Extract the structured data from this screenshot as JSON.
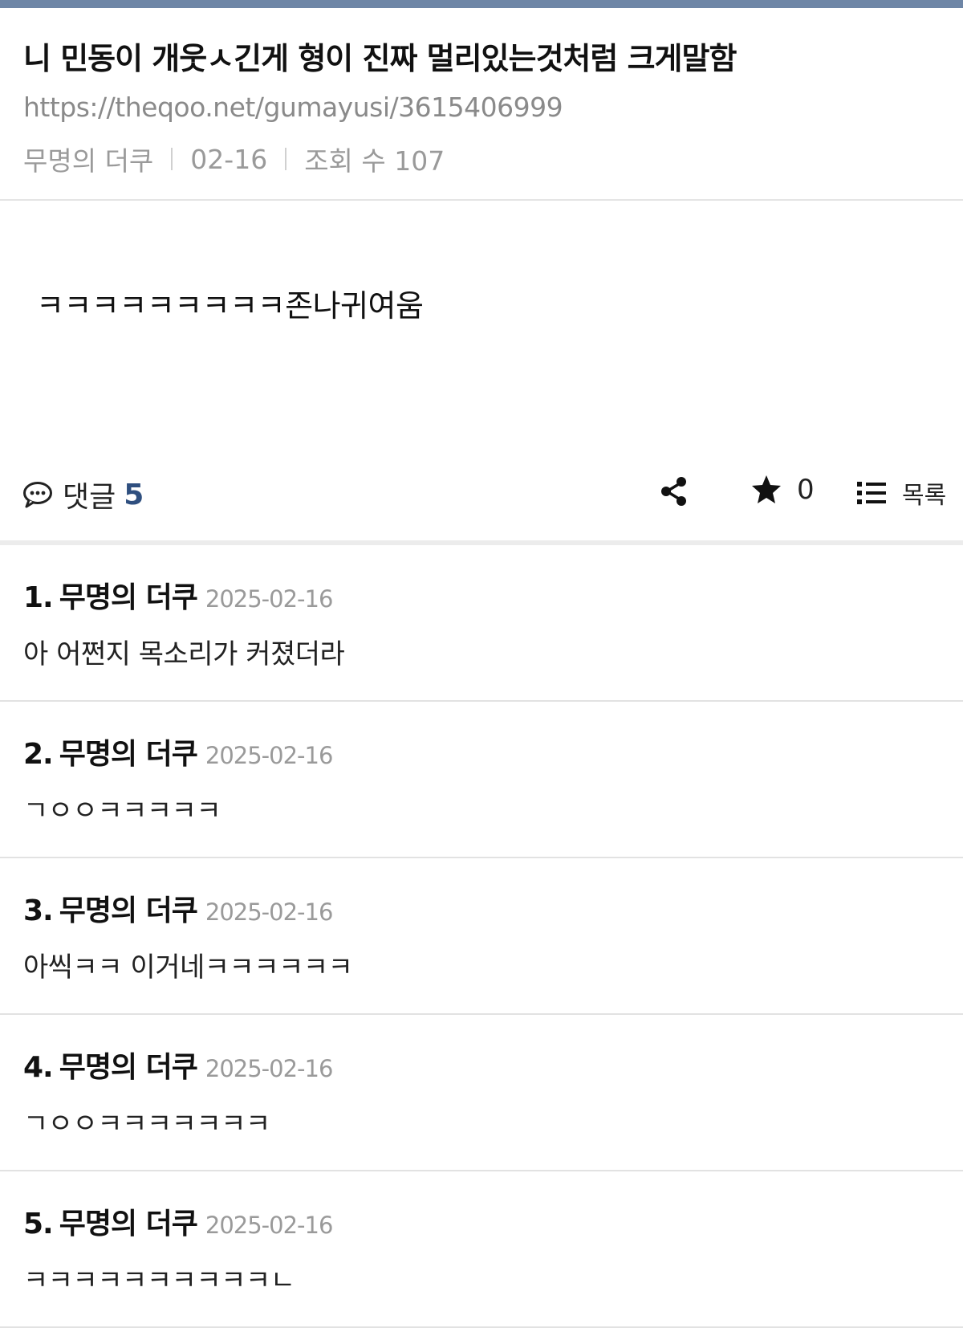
{
  "post": {
    "title": "니 민동이 개웃ㅅ긴게 형이 진짜 멀리있는것처럼 크게말함",
    "url": "https://theqoo.net/gumayusi/3615406999",
    "author": "무명의 더쿠",
    "date": "02-16",
    "views": "조회 수 107",
    "body": "ㅋㅋㅋㅋㅋㅋㅋㅋㅋ존나귀여움"
  },
  "actions": {
    "comment_label": "댓글",
    "comment_count": "5",
    "star_count": "0",
    "list_label": "목록"
  },
  "comments": [
    {
      "num": "1.",
      "author": "무명의 더쿠",
      "date": "2025-02-16",
      "text": "아 어쩐지 목소리가 커졌더라"
    },
    {
      "num": "2.",
      "author": "무명의 더쿠",
      "date": "2025-02-16",
      "text": "ㄱㅇㅇㅋㅋㅋㅋㅋ"
    },
    {
      "num": "3.",
      "author": "무명의 더쿠",
      "date": "2025-02-16",
      "text": "아씩ㅋㅋ 이거네ㅋㅋㅋㅋㅋㅋ"
    },
    {
      "num": "4.",
      "author": "무명의 더쿠",
      "date": "2025-02-16",
      "text": "ㄱㅇㅇㅋㅋㅋㅋㅋㅋㅋ"
    },
    {
      "num": "5.",
      "author": "무명의 더쿠",
      "date": "2025-02-16",
      "text": "ㅋㅋㅋㅋㅋㅋㅋㅋㅋㅋㄴ"
    }
  ],
  "colors": {
    "topbar": "#6e86a6",
    "accent_count": "#2f4f7f"
  },
  "icons": [
    "comment-icon",
    "share-icon",
    "star-icon",
    "list-icon"
  ]
}
